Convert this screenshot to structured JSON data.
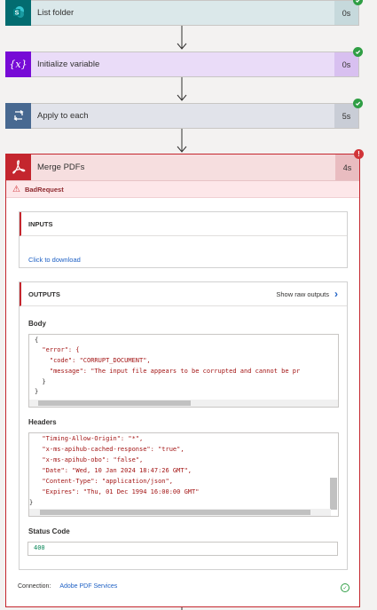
{
  "steps": [
    {
      "title": "List folder",
      "duration": "0s",
      "status": "success",
      "accent": "#dbe8ea",
      "icon_bg": "#036c70",
      "dur_bg": "#c6d9dc",
      "icon": "sharepoint-icon"
    },
    {
      "title": "Initialize variable",
      "duration": "0s",
      "status": "success",
      "accent": "#eadcf8",
      "icon_bg": "#770bd6",
      "dur_bg": "#d8c0f0",
      "icon": "variable-icon"
    },
    {
      "title": "Apply to each",
      "duration": "5s",
      "status": "success",
      "accent": "#e1e3ea",
      "icon_bg": "#486991",
      "dur_bg": "#c9cdd6",
      "icon": "loop-icon"
    }
  ],
  "merge": {
    "title": "Merge PDFs",
    "duration": "4s",
    "error_badge": "!",
    "error_text": "BadRequest",
    "inputs": {
      "header": "INPUTS",
      "link": "Click to download"
    },
    "outputs": {
      "header": "OUTPUTS",
      "show_raw": "Show raw outputs",
      "body_label": "Body",
      "body_lines": [
        "{",
        "  \"error\": {",
        "    \"code\": \"CORRUPT_DOCUMENT\",",
        "    \"message\": \"The input file appears to be corrupted and cannot be pr",
        "  }",
        "}"
      ],
      "headers_label": "Headers",
      "headers_lines": [
        "  \"Timing-Allow-Origin\": \"*\",",
        "  \"x-ms-apihub-cached-response\": \"true\",",
        "  \"x-ms-apihub-obo\": \"false\",",
        "  \"Date\": \"Wed, 10 Jan 2024 18:47:26 GMT\",",
        "  \"Content-Type\": \"application/json\",",
        "  \"Expires\": \"Thu, 01 Dec 1994 16:00:00 GMT\"",
        "}"
      ],
      "status_label": "Status Code",
      "status_value": "400"
    },
    "connection_label": "Connection:",
    "connection_name": "Adobe PDF Services"
  }
}
